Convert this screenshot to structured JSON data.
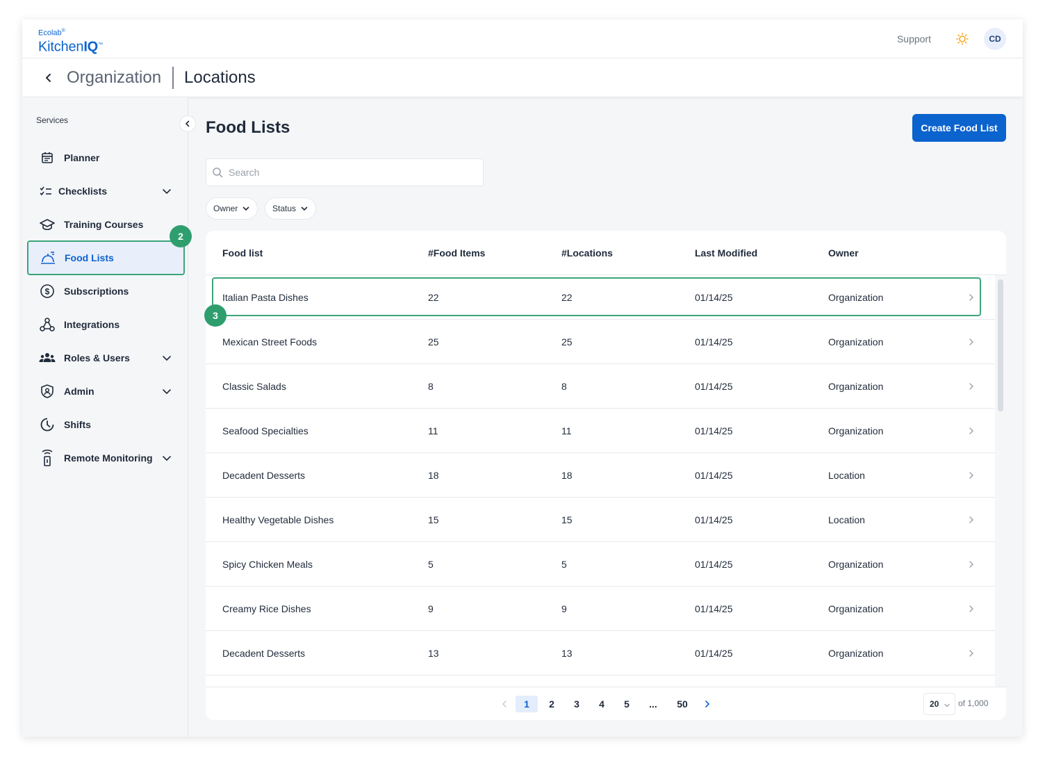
{
  "brand": {
    "small": "Ecolab",
    "big_prefix": "Kitchen",
    "big_bold": "IQ"
  },
  "header": {
    "support_label": "Support",
    "avatar_initials": "CD"
  },
  "breadcrumb": {
    "parent": "Organization",
    "current": "Locations"
  },
  "sidebar": {
    "section_label": "Services",
    "items": [
      {
        "label": "Planner",
        "icon": "calendar-icon",
        "expandable": false
      },
      {
        "label": "Checklists",
        "icon": "checklist-icon",
        "expandable": true
      },
      {
        "label": "Training Courses",
        "icon": "graduation-cap-icon",
        "expandable": false
      },
      {
        "label": "Food Lists",
        "icon": "food-tray-icon",
        "expandable": false,
        "active": true
      },
      {
        "label": "Subscriptions",
        "icon": "dollar-circle-icon",
        "expandable": false
      },
      {
        "label": "Integrations",
        "icon": "webhook-icon",
        "expandable": false
      },
      {
        "label": "Roles & Users",
        "icon": "users-icon",
        "expandable": true
      },
      {
        "label": "Admin",
        "icon": "shield-user-icon",
        "expandable": true
      },
      {
        "label": "Shifts",
        "icon": "clock-icon",
        "expandable": false
      },
      {
        "label": "Remote Monitoring",
        "icon": "sensor-icon",
        "expandable": true
      }
    ]
  },
  "annotations": {
    "sidebar_badge": "2",
    "row_badge": "3"
  },
  "main": {
    "title": "Food Lists",
    "create_button": "Create Food List",
    "search_placeholder": "Search",
    "filters": [
      "Owner",
      "Status"
    ]
  },
  "table": {
    "columns": [
      "Food list",
      "#Food Items",
      "#Locations",
      "Last Modified",
      "Owner"
    ],
    "rows": [
      [
        "Italian Pasta Dishes",
        "22",
        "22",
        "01/14/25",
        "Organization"
      ],
      [
        "Mexican Street Foods",
        "25",
        "25",
        "01/14/25",
        "Organization"
      ],
      [
        "Classic Salads",
        "8",
        "8",
        "01/14/25",
        "Organization"
      ],
      [
        "Seafood Specialties",
        "11",
        "11",
        "01/14/25",
        "Organization"
      ],
      [
        "Decadent Desserts",
        "18",
        "18",
        "01/14/25",
        "Location"
      ],
      [
        "Healthy Vegetable Dishes",
        "15",
        "15",
        "01/14/25",
        "Location"
      ],
      [
        "Spicy Chicken Meals",
        "5",
        "5",
        "01/14/25",
        "Organization"
      ],
      [
        "Creamy Rice Dishes",
        "9",
        "9",
        "01/14/25",
        "Organization"
      ],
      [
        "Decadent Desserts",
        "13",
        "13",
        "01/14/25",
        "Organization"
      ]
    ]
  },
  "pagination": {
    "pages": [
      "1",
      "2",
      "3",
      "4",
      "5",
      "...",
      "50"
    ],
    "current": "1",
    "page_size": "20",
    "total_label": "of 1,000"
  },
  "colors": {
    "accent": "#0b63ce",
    "highlight": "#3aa57a",
    "sun": "#f5a623"
  }
}
